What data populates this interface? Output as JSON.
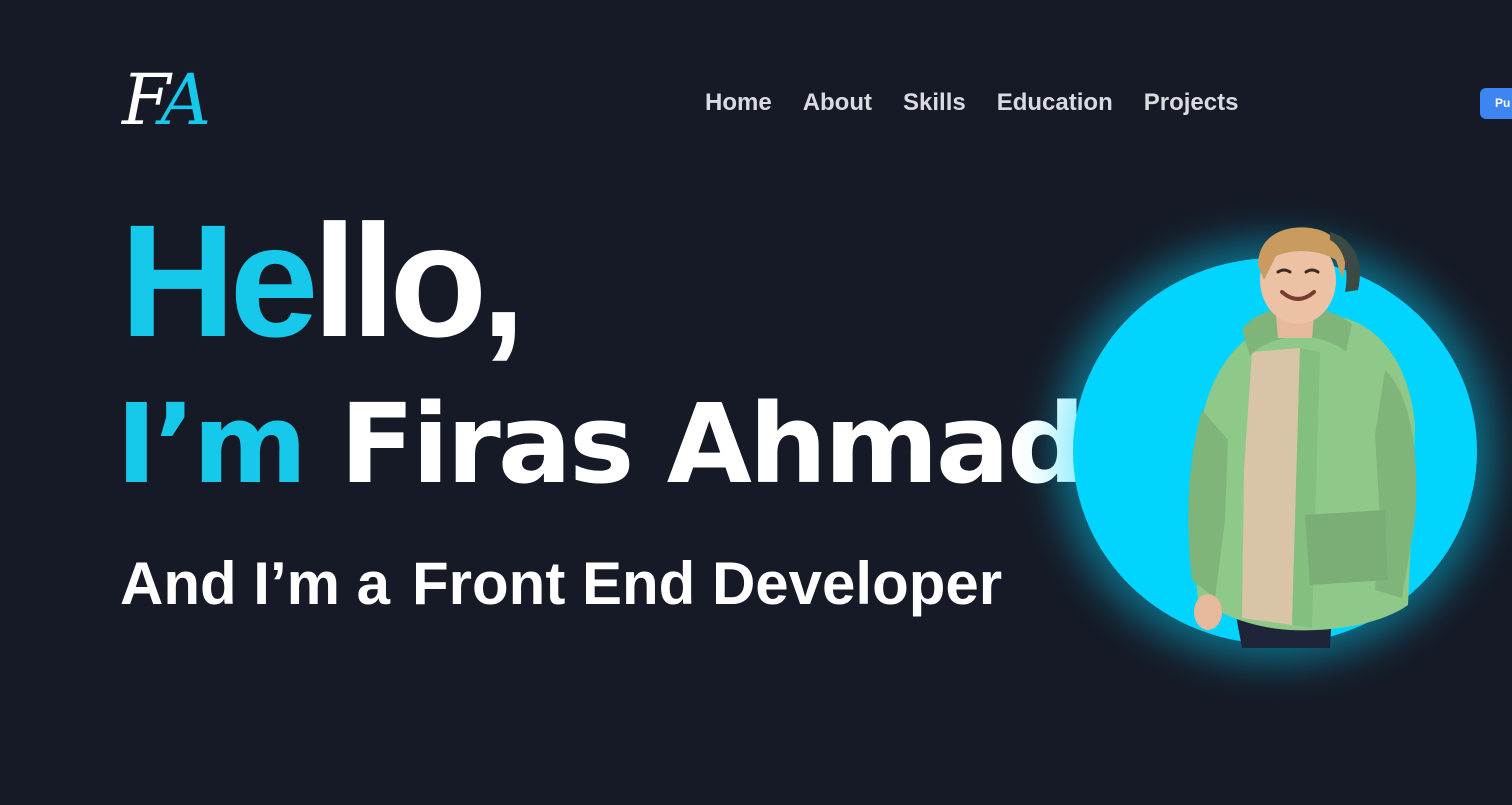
{
  "logo": {
    "first": "F",
    "second": "A"
  },
  "nav": {
    "items": [
      {
        "label": "Home"
      },
      {
        "label": "About"
      },
      {
        "label": "Skills"
      },
      {
        "label": "Education"
      },
      {
        "label": "Projects"
      }
    ]
  },
  "header_button": {
    "label": "Pu"
  },
  "hero": {
    "hello_accent": "He",
    "hello_rest": "llo,",
    "intro_accent": "I’m",
    "name": "Firas Ahmad",
    "role_prefix": "And I’m a",
    "role": "Front End Developer"
  },
  "colors": {
    "background": "#161a26",
    "accent": "#16c8ea",
    "circle": "#00d4ff",
    "button": "#3d86f1",
    "hoodie": "#8fc98a"
  }
}
